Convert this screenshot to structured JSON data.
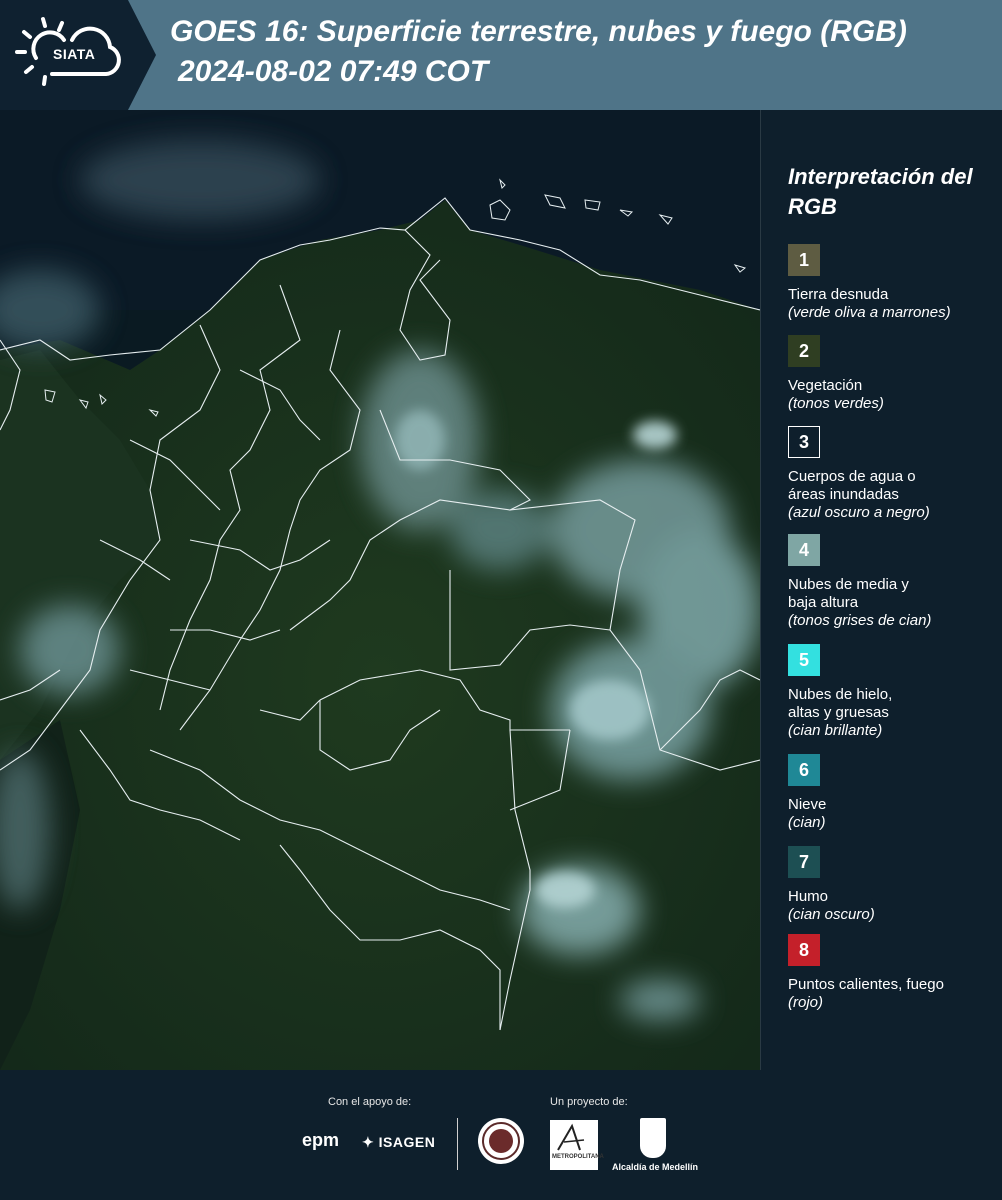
{
  "header": {
    "logo_text": "SIATA",
    "title": "GOES 16: Superficie terrestre, nubes y fuego (RGB)",
    "datetime": "2024-08-02 07:49 COT"
  },
  "legend": {
    "title": "Interpretación del RGB",
    "items": [
      {
        "num": "1",
        "label": "Tierra desnuda",
        "sub": "(verde oliva a marrones)",
        "color": "#5e5c42"
      },
      {
        "num": "2",
        "label": "Vegetación",
        "sub": "(tonos verdes)",
        "color": "#2f3e22"
      },
      {
        "num": "3",
        "label": "Cuerpos de agua o\náreas inundadas",
        "sub": "(azul oscuro a negro)",
        "color": "#0e1f2c"
      },
      {
        "num": "4",
        "label": "Nubes de media y\nbaja altura",
        "sub": "(tonos grises de cian)",
        "color": "#7fa6a4"
      },
      {
        "num": "5",
        "label": "Nubes de hielo,\naltas y gruesas",
        "sub": "(cian brillante)",
        "color": "#33e0e0"
      },
      {
        "num": "6",
        "label": "Nieve",
        "sub": "(cian)",
        "color": "#1f8896"
      },
      {
        "num": "7",
        "label": "Humo",
        "sub": "(cian oscuro)",
        "color": "#1d4f53"
      },
      {
        "num": "8",
        "label": "Puntos calientes, fuego",
        "sub": "(rojo)",
        "color": "#c4202a"
      }
    ]
  },
  "footer": {
    "support_label": "Con el apoyo de:",
    "project_label": "Un proyecto de:",
    "sponsor_1": "epm",
    "sponsor_2": "ISAGEN",
    "partner_area": "METROPOLITANA",
    "partner_medellin": "Alcaldía de Medellín"
  },
  "colors": {
    "header_bg": "#4f7488",
    "panel_bg": "#0e1f2c"
  }
}
